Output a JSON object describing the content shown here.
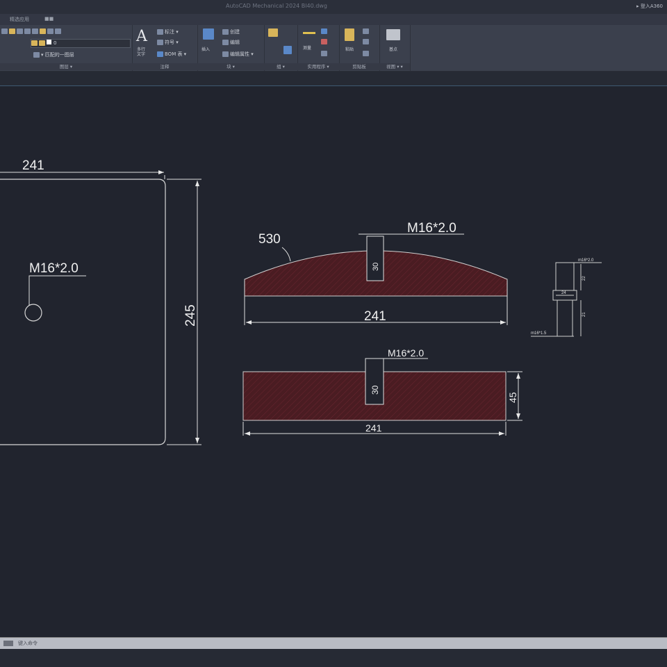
{
  "app": {
    "title": "AutoCAD Mechanical 2024  Bl40.dwg",
    "signin": "▸ 登入A360"
  },
  "tabs": [
    "精选应用",
    "■■"
  ],
  "ribbon": {
    "panels": [
      {
        "label": "图层 ▾"
      },
      {
        "label": "注释"
      },
      {
        "label": "块 ▾"
      },
      {
        "label": "组 ▾"
      },
      {
        "label": "实用程序 ▾"
      },
      {
        "label": "剪贴板"
      },
      {
        "label": "视图 ▾ ▾"
      }
    ],
    "layer_value": "0",
    "layer_match": "▾ 匹配的一图层",
    "text_label": "多行\n文字",
    "annot_items": [
      "标注 ▾",
      "符号 ▾",
      "BOM 表 ▾"
    ],
    "block_items": [
      "创建",
      "编辑",
      "编辑属性 ▾"
    ],
    "insert_label": "插入",
    "measure_label": "测量",
    "paste_label": "粘贴",
    "base_label": "基点"
  },
  "drawing": {
    "plate": {
      "width_dim": "241",
      "height_dim": "245",
      "hole_label": "M16*2.0"
    },
    "arc_part": {
      "arc_dim": "530",
      "hole_label": "M16*2.0",
      "depth_dim": "30",
      "width_dim": "241"
    },
    "flat_part": {
      "hole_label": "M16*2.0",
      "depth_dim": "30",
      "width_dim": "241",
      "height_dim": "45"
    },
    "detail": {
      "top_label": "m16*2.0",
      "bot_label": "m16*1.5",
      "dim_a": "24",
      "dim_b": "22",
      "dim_c": "21"
    }
  },
  "command": {
    "text": "键入命令"
  }
}
